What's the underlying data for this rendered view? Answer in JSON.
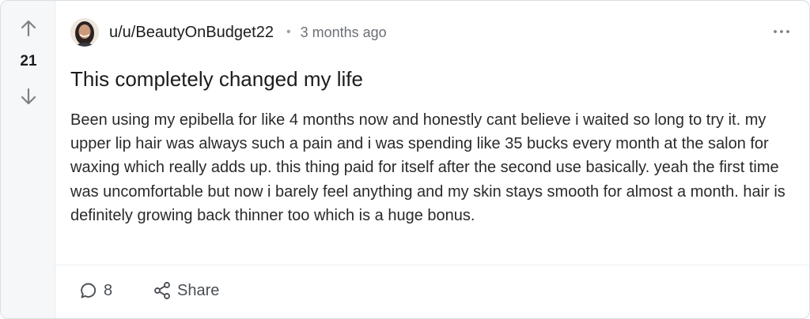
{
  "vote": {
    "count": "21"
  },
  "post": {
    "author": "u/u/BeautyOnBudget22",
    "separator": "•",
    "time": "3 months ago",
    "title": "This completely changed my life",
    "body": "Been using my epibella for like 4 months now and honestly cant believe i waited so long to try it. my upper lip hair was always such a pain and i was spending like 35 bucks every month at the salon for waxing which really adds up. this thing paid for itself after the second use basically. yeah the first time was uncomfortable but now i barely feel anything and my skin stays smooth for almost a month. hair is definitely growing back thinner too which is a huge bonus."
  },
  "actions": {
    "comments_count": "8",
    "share_label": "Share"
  },
  "icons": {
    "upvote": "arrow-up-icon",
    "downvote": "arrow-down-icon",
    "menu": "more-horizontal-icon",
    "comments": "comment-bubble-icon",
    "share": "share-icon"
  },
  "colors": {
    "text": "#1c1c1c",
    "muted": "#6b7075",
    "icon": "#7c8186",
    "vote_bg": "#f6f7f8",
    "border": "#d9dde1"
  }
}
